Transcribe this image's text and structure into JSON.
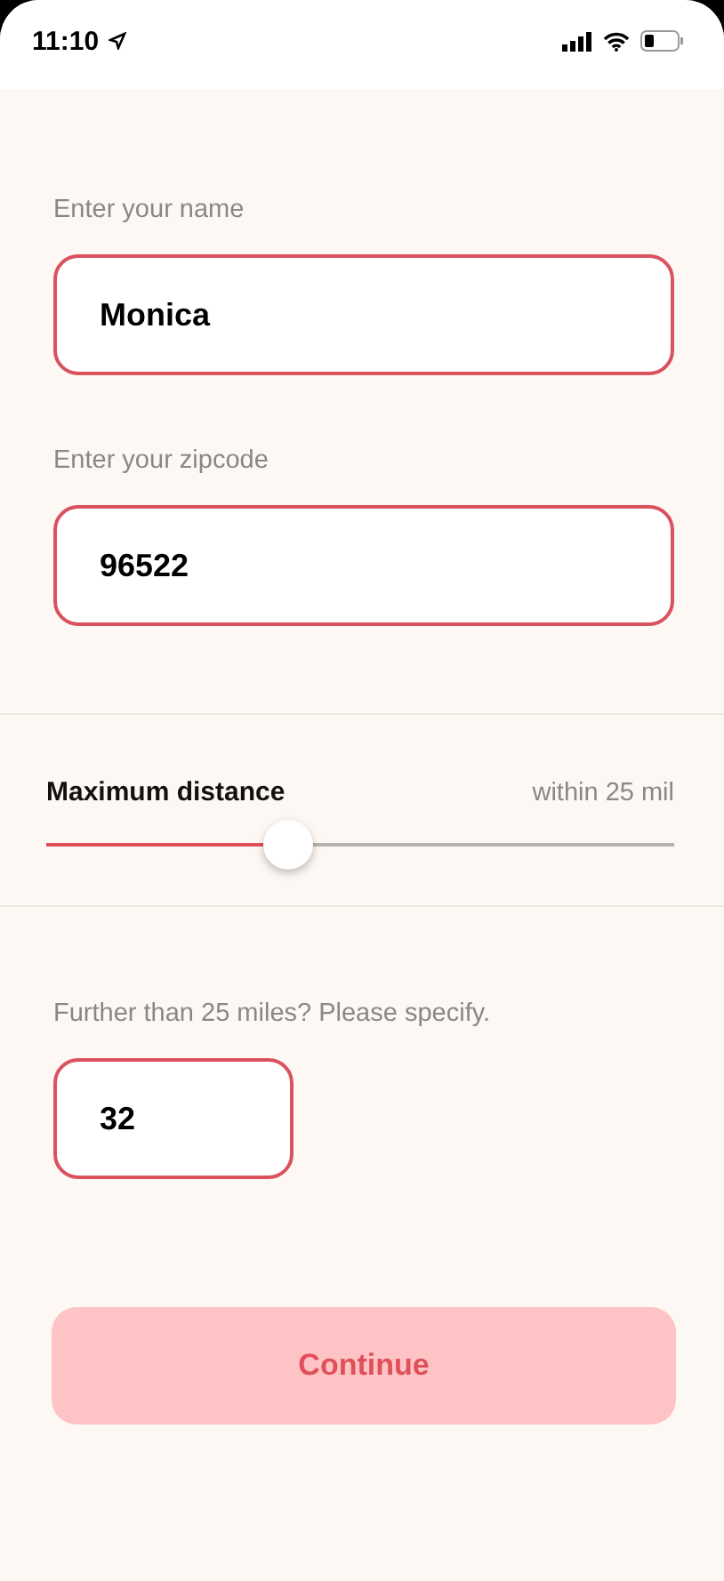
{
  "status_bar": {
    "time": "11:10"
  },
  "fields": [
    {
      "label": "Enter your name",
      "value": "Monica"
    },
    {
      "label": "Enter your zipcode",
      "value": "96522"
    }
  ],
  "distance": {
    "label": "Maximum distance",
    "reading": "within 25 mil",
    "level": 0.385
  },
  "further": {
    "label": "Further than 25 miles? Please specify.",
    "value": "32"
  },
  "button": {
    "label": "Continue"
  }
}
